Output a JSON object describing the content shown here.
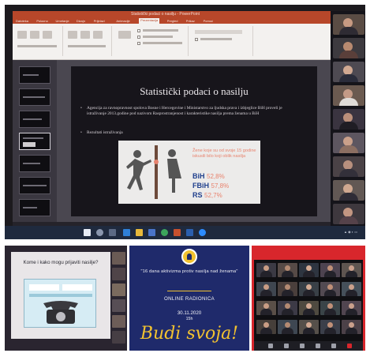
{
  "top_screen": {
    "window_title": "Statistički podaci o nasilju - PowerPoint",
    "menu": [
      "Datoteka",
      "Polazno",
      "Umetanje",
      "Dizajn",
      "Prijelazi",
      "Animacije",
      "Prezentacija",
      "Pregled",
      "Prikaz",
      "Pomoć"
    ],
    "active_menu_index": 6,
    "slide": {
      "title": "Statistički podaci o nasilju",
      "bullets": [
        "Agencija za ravnopravnost spolova Bosne i Hercegovine i Ministarstvo za ljudska prava i izbjeglice BiH proveli je istraživanje 2013.godine pod nazivom Rasprostranjenost i karakteristike nasilja prema ženama u BiH",
        "Rezultati istraživanja"
      ],
      "infographic": {
        "caption": "Žene koje su od svoje 15 godine iskusili bilo koji oblik nasilja",
        "stats": [
          {
            "label": "BiH",
            "value": "52,8%"
          },
          {
            "label": "FBiH",
            "value": "57,8%"
          },
          {
            "label": "RS",
            "value": "52,7%"
          }
        ]
      }
    },
    "icons": {
      "taskbar": [
        "windows-start-icon",
        "search-icon",
        "task-view-icon",
        "edge-icon",
        "explorer-icon",
        "store-icon",
        "chrome-icon",
        "powerpoint-icon",
        "word-icon",
        "zoom-icon"
      ]
    },
    "colors": {
      "ppt_accent": "#b7472a",
      "infographic_orange": "#e8836e",
      "infographic_blue": "#1f3f8c"
    }
  },
  "bottom_left": {
    "slide_title": "Kome i kako mogu prijaviti nasilje?"
  },
  "poster": {
    "quote": "\"16 dana aktivizma protiv nasilja nad ženama\"",
    "subtitle": "ONLINE RADIONICA",
    "date": "30.11.2020",
    "time": "15h",
    "motto": "Budi svoja!",
    "colors": {
      "background": "#1f2a6b",
      "accent": "#f2c230"
    }
  },
  "bottom_right": {
    "description_icons": [
      "mic-icon",
      "camera-icon",
      "participants-icon",
      "chat-icon",
      "share-screen-icon",
      "leave-icon"
    ]
  }
}
